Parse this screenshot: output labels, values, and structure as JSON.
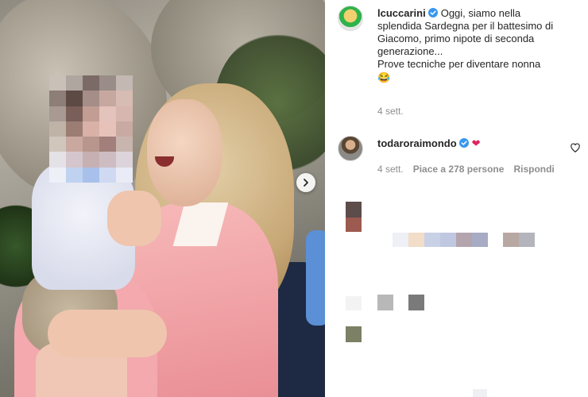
{
  "post": {
    "author": "lcuccarini",
    "caption_lines": [
      "Oggi, siamo nella",
      "splendida Sardegna per il battesimo di",
      "Giacomo, primo nipote di seconda",
      "generazione...",
      "Prove tecniche per diventare nonna"
    ],
    "caption_emoji": "😂",
    "time_ago": "4 sett."
  },
  "comments": [
    {
      "username": "todaroraimondo",
      "text_emoji": "❤",
      "time_ago": "4 sett.",
      "likes": "Piace a 278 persone",
      "reply_label": "Rispondi"
    }
  ],
  "icons": {
    "verified": "verified-badge-icon",
    "next": "chevron-right-icon",
    "like": "heart-outline-icon"
  },
  "colors": {
    "verified_blue": "#3897f0",
    "heart_red": "#e0245e",
    "secondary_text": "#8e8e8e"
  }
}
